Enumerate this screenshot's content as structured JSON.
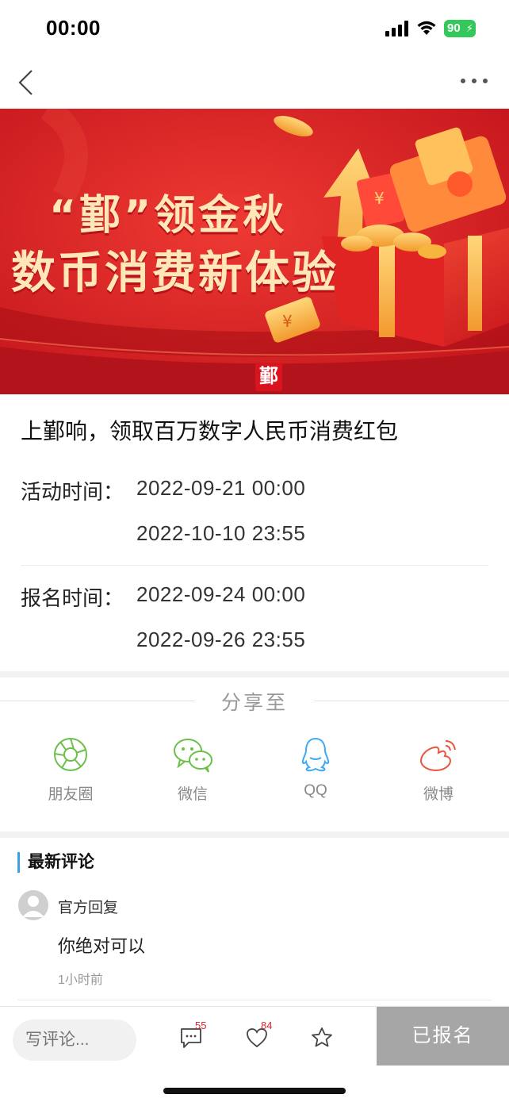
{
  "status_bar": {
    "time": "00:00",
    "battery": "90"
  },
  "banner": {
    "line1": "“鄞”领金秋",
    "line2": "数币消费新体验",
    "logo_char": "鄞",
    "colors": {
      "bg": "#d51f25",
      "gold": "#ffe7b8"
    }
  },
  "activity": {
    "title": "上鄞响，领取百万数字人民币消费红包",
    "activity_time_label": "活动时间：",
    "activity_start": "2022-09-21 00:00",
    "activity_end": "2022-10-10 23:55",
    "signup_time_label": "报名时间：",
    "signup_start": "2022-09-24 00:00",
    "signup_end": "2022-09-26 23:55"
  },
  "share": {
    "title": "分享至",
    "items": [
      {
        "label": "朋友圈",
        "icon": "moments-icon",
        "color": "#6cc04a"
      },
      {
        "label": "微信",
        "icon": "wechat-icon",
        "color": "#6cc04a"
      },
      {
        "label": "QQ",
        "icon": "qq-icon",
        "color": "#3fa9f5"
      },
      {
        "label": "微博",
        "icon": "weibo-icon",
        "color": "#e8573f"
      }
    ]
  },
  "comments": {
    "header": "最新评论",
    "items": [
      {
        "author": "官方回复",
        "text": "你绝对可以",
        "time": "1小时前"
      }
    ]
  },
  "bottom_bar": {
    "input_placeholder": "写评论...",
    "comment_count": "55",
    "like_count": "84",
    "signed_label": "已报名"
  }
}
